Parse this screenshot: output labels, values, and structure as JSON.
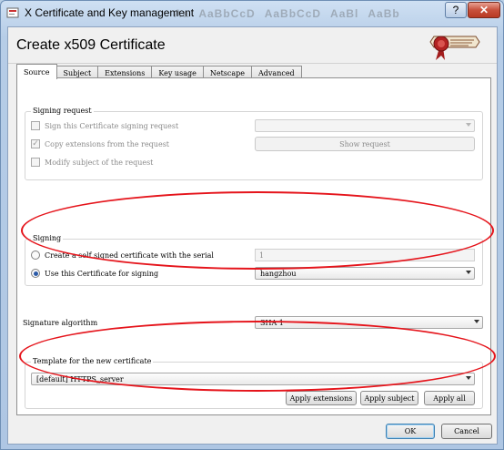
{
  "window": {
    "title": "X Certificate and Key management",
    "background_ghost": [
      "Aa",
      "AaBbCcD",
      "AaBbCcD",
      "AaBl",
      "AaBb"
    ]
  },
  "dialog": {
    "title": "Create x509 Certificate"
  },
  "tabs": [
    {
      "label": "Source",
      "active": true
    },
    {
      "label": "Subject",
      "active": false
    },
    {
      "label": "Extensions",
      "active": false
    },
    {
      "label": "Key usage",
      "active": false
    },
    {
      "label": "Netscape",
      "active": false
    },
    {
      "label": "Advanced",
      "active": false
    }
  ],
  "signing_request": {
    "group_title": "Signing request",
    "sign_csr_label": "Sign this Certificate signing request",
    "sign_csr_checked": false,
    "copy_ext_label": "Copy extensions from the request",
    "copy_ext_checked": true,
    "modify_subject_label": "Modify subject of the request",
    "modify_subject_checked": false,
    "request_select_value": "",
    "show_request_label": "Show request"
  },
  "signing": {
    "group_title": "Signing",
    "self_signed_label": "Create a self signed certificate with the serial",
    "self_signed_selected": false,
    "serial_value": "1",
    "use_cert_label": "Use this Certificate for signing",
    "use_cert_selected": true,
    "signing_cert_value": "hangzhou"
  },
  "signature": {
    "label": "Signature algorithm",
    "value": "SHA 1"
  },
  "template": {
    "group_title": "Template for the new certificate",
    "value": "[default] HTTPS_server",
    "apply_extensions_label": "Apply extensions",
    "apply_subject_label": "Apply subject",
    "apply_all_label": "Apply all"
  },
  "footer": {
    "ok_label": "OK",
    "cancel_label": "Cancel"
  },
  "colors": {
    "annotation_oval": "#e5141b",
    "close_button": "#c8503b",
    "radio_dot": "#2b5aa7"
  }
}
